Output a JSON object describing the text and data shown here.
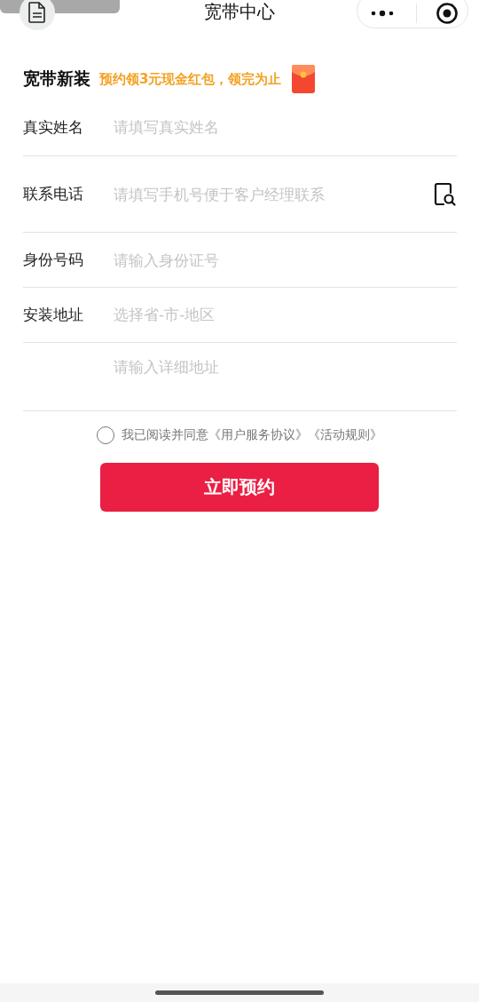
{
  "nav": {
    "title": "宽带中心"
  },
  "promo": {
    "title": "宽带新装",
    "subtitle": "预约领3元现金红包，领完为止"
  },
  "fields": [
    {
      "kind": "input",
      "label": "真实姓名",
      "placeholder": "请填写真实姓名"
    },
    {
      "kind": "input",
      "label": "联系电话",
      "placeholder": "请填写手机号便于客户经理联系",
      "contact_picker": true
    },
    {
      "kind": "input",
      "label": "身份号码",
      "placeholder": "请输入身份证号"
    },
    {
      "kind": "picker",
      "label": "安装地址",
      "placeholder": "选择省-市-地区"
    },
    {
      "kind": "textarea",
      "placeholder": "请输入详细地址"
    }
  ],
  "agreement": {
    "checked": false,
    "text": "我已阅读并同意《用户服务协议》《活动规则》"
  },
  "submit": "立即预约"
}
